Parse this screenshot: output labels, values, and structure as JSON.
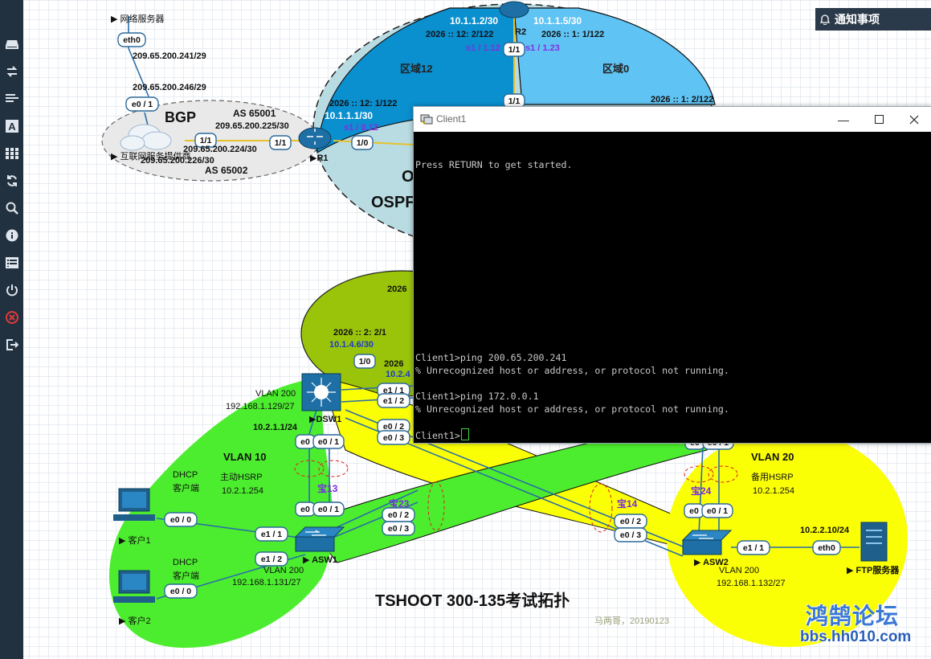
{
  "sidebar": {
    "items": [
      {
        "icon": "hard-drive-icon"
      },
      {
        "icon": "transfer-arrows-icon"
      },
      {
        "icon": "align-left-icon"
      },
      {
        "icon": "text-a-icon"
      },
      {
        "icon": "grid-icon"
      },
      {
        "icon": "refresh-icon"
      },
      {
        "icon": "zoom-icon"
      },
      {
        "icon": "info-icon"
      },
      {
        "icon": "list-icon"
      },
      {
        "icon": "power-icon"
      },
      {
        "icon": "stop-icon"
      },
      {
        "icon": "logout-icon"
      }
    ]
  },
  "notification": {
    "label": "通知事项"
  },
  "terminal": {
    "title": "Client1",
    "lines": [
      "Press RETURN to get started.",
      "Client1>ping 200.65.200.241",
      "% Unrecognized host or address, or protocol not running.",
      "Client1>ping 172.0.0.1",
      "% Unrecognized host or address, or protocol not running.",
      "Client1>"
    ]
  },
  "topology": {
    "title": "TSHOOT 300-135考试拓扑",
    "signature": "马两哥，20190123",
    "watermark": {
      "cn": "鸿鹄论坛",
      "url": "bbs.hh010.com"
    },
    "colors": {
      "area12": "#0a8fcf",
      "area0": "#5fc3f3",
      "ospf_bg": "#b9dce3",
      "olive": "#9ac40a",
      "green": "#4ced2e",
      "yellow": "#fbff05",
      "bgp": "#e8e8e8"
    },
    "labels": {
      "net_server": "网络服务器",
      "eth0": "eth0",
      "ip_241": "209.65.200.241/29",
      "ip_246": "209.65.200.246/29",
      "e0_1": "e0 / 1",
      "bgp": "BGP",
      "as65001": "AS 65001",
      "ip_225": "209.65.200.225/30",
      "ip_224": "209.65.200.224/30",
      "ip_226": "209.65.200.226/30",
      "isp": "互联网服务提供商",
      "as65002": "AS 65002",
      "p_1_1": "1/1",
      "p_1_0": "1/0",
      "r1_v6": "2026 :: 12:  1/122",
      "r1_ip": "10.1.1.1/30",
      "r1_s1": "s1 / 0.12",
      "r1": "R1",
      "r2_ipl": "10.1.1.2/30",
      "r2_ipr": "10.1.1.5/30",
      "r2_v6l": "2026 :: 12:  2/122",
      "r2_v6r": "2026 :: 1:  1/122",
      "r2": "R2",
      "r2_s1l": "s1 / 1.12",
      "r2_s1r": "s1 / 1.23",
      "area12": "区域12",
      "area0": "区域0",
      "r3_v6": "2026 :: 1:  2/122",
      "ospf_o": "O",
      "ospf": "OSPF",
      "v6_2_2": "2026 :: 2:  2/1",
      "ip_1046": "10.1.4.6/30",
      "v6_2026": "2026",
      "ip_1024": "10.2.4",
      "vlan200": "VLAN 200",
      "dsw1_ip": "192.168.1.129/27",
      "dsw1_v10": "10.2.1.1/24",
      "dsw1": "DSW1",
      "e0": "e0",
      "e0_1b": "e0 / 1",
      "e1_1": "e1 / 1",
      "e1_2": "e1 / 2",
      "e0_2": "e0 / 2",
      "e0_3": "e0 / 3",
      "vlan10": "VLAN 10",
      "dhcp": "DHCP",
      "client_end": "客户端",
      "hsrp_main": "主动HSRP",
      "hsrp_main_ip": "10.2.1.254",
      "bao13": "宝13",
      "bao23": "宝23",
      "bao14": "宝14",
      "bao24": "宝24",
      "e0_0": "e0 / 0",
      "client1": "客户1",
      "client2": "客户2",
      "asw1": "ASW1",
      "asw1_ip": "192.168.1.131/27",
      "vlan20": "VLAN 20",
      "hsrp_bak": "备用HSRP",
      "hsrp_bak_ip": "10.2.1.254",
      "asw2": "ASW2",
      "asw2_ip": "192.168.1.132/27",
      "ftp_ip": "10.2.2.10/24",
      "ftp": "FTP服务器"
    }
  }
}
